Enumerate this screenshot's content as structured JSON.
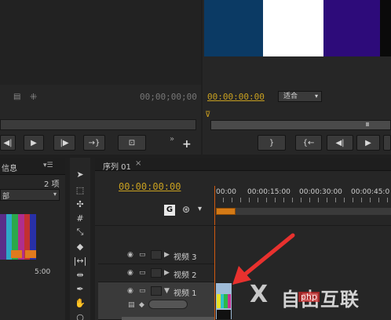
{
  "source_monitor": {
    "timecode": "00;00;00;00"
  },
  "program_monitor": {
    "timecode": "00:00:00:00",
    "fit_option": "适合",
    "color_bars": [
      "#0b3a64",
      "#ffffff",
      "#2d0b7a",
      "#0a0a0a"
    ]
  },
  "project_panel": {
    "tab_info": "信息",
    "item_count": "2 项",
    "bin_label": "部",
    "duration": "5:00"
  },
  "sequence": {
    "tab_label": "序列 01",
    "close_glyph": "×",
    "timecode": "00:00:00:00",
    "ruler": [
      "00:00",
      "00:00:15:00",
      "00:00:30:00",
      "00:00:45:0"
    ],
    "tracks": [
      {
        "name": "视频 3"
      },
      {
        "name": "视频 2"
      },
      {
        "name": "视频 1"
      }
    ]
  },
  "watermark": {
    "text": "自由互联",
    "sub": "php"
  },
  "annotation": {
    "arrow_color": "#e8312e"
  }
}
